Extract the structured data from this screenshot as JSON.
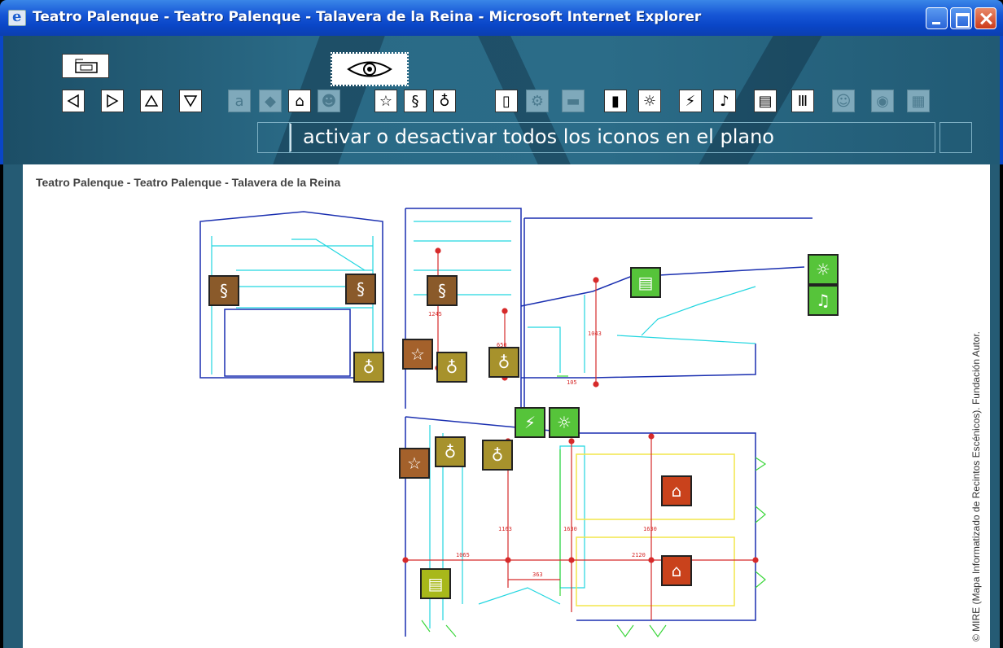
{
  "window": {
    "title": "Teatro Palenque - Teatro Palenque - Talavera de la Reina - Microsoft Internet Explorer"
  },
  "toolbar": {
    "nav_icons": [
      "arrow-left-icon",
      "arrow-right-icon",
      "arrow-up-icon",
      "arrow-down-icon"
    ],
    "status_text": "activar o desactivar todos los iconos en el plano"
  },
  "content": {
    "title": "Teatro Palenque - Teatro Palenque - Talavera de la Reina",
    "copyright": "© MIRE (Mapa Informatizado de Recintos Escénicos). Fundación Autor.",
    "dimensions": [
      "1245",
      "650",
      "1043",
      "105",
      "1163",
      "1630",
      "1630",
      "1065",
      "2120",
      "363"
    ]
  },
  "colors": {
    "titlebar": "#0a46c8",
    "toolbar_bg": "#2a6a86",
    "plan_blue": "#1a2fb0",
    "plan_cyan": "#22d6e0",
    "plan_red": "#d62a2a",
    "plan_yellow": "#f2e64a",
    "plan_green": "#3ad63a"
  }
}
